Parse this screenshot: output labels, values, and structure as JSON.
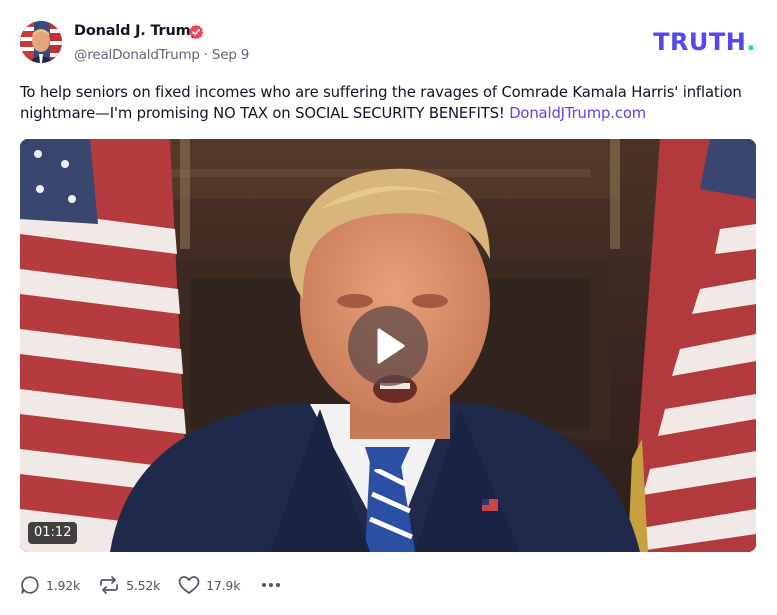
{
  "author": {
    "name": "Donald J. Trump",
    "handle": "@realDonaldTrump",
    "date": "Sep 9",
    "verified_icon": "verified-badge-icon",
    "verified_color": "#f0445a"
  },
  "logo": {
    "text": "TRUTH",
    "dot": ".",
    "color": "#5448ee",
    "dot_color": "#19dfa6"
  },
  "post": {
    "text": "To help seniors on fixed incomes who are suffering the ravages of Comrade Kamala Harris' inflation nightmare—I'm promising NO TAX on SOCIAL SECURITY BENEFITS! ",
    "link": "DonaldJTrump.com",
    "link_color": "#5448ee"
  },
  "video": {
    "duration": "01:12",
    "play_icon": "play-icon"
  },
  "actions": {
    "replies": "1.92k",
    "retruths": "5.52k",
    "likes": "17.9k",
    "reply_icon": "reply-icon",
    "retruth_icon": "retruth-icon",
    "like_icon": "heart-icon",
    "more_icon": "more-icon"
  }
}
